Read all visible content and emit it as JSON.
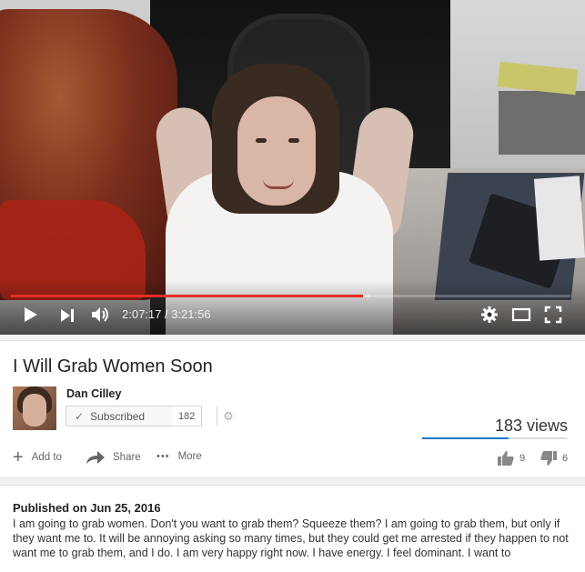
{
  "player": {
    "current_time": "2:07:17",
    "separator": " / ",
    "duration": "3:21:56",
    "played_fraction": 0.63,
    "buffered_fraction": 0.64
  },
  "video": {
    "title": "I Will Grab Women Soon",
    "views": "183 views"
  },
  "channel": {
    "name": "Dan Cilley",
    "subscribe_label": "Subscribed",
    "subscriber_count": "182"
  },
  "actions": {
    "add_to": "Add to",
    "share": "Share",
    "more": "More",
    "likes": "9",
    "dislikes": "6"
  },
  "description": {
    "published": "Published on Jun 25, 2016",
    "text": "I am going to grab women. Don't you want to grab them? Squeeze them? I am going to grab them, but only if they want me to. It will be annoying asking so many times, but they could get me arrested if they happen to not want me to grab them, and I do. I am very happy right now. I have energy. I feel dominant. I want to"
  },
  "colors": {
    "progress_played": "#e52d27",
    "views_bar": "#167ac6"
  },
  "icons": {
    "play": "play-icon",
    "next": "next-icon",
    "volume": "volume-icon",
    "settings": "gear-icon",
    "theater": "theater-mode-icon",
    "fullscreen": "fullscreen-icon",
    "check": "check-icon",
    "add": "plus-icon",
    "share": "share-arrow-icon",
    "more": "more-dots-icon",
    "like": "thumbs-up-icon",
    "dislike": "thumbs-down-icon"
  }
}
